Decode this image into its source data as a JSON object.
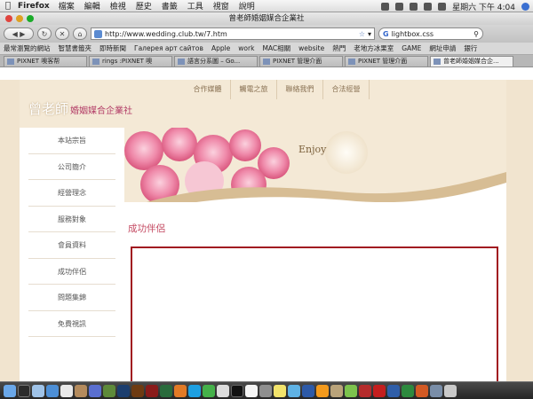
{
  "menubar": {
    "app": "Firefox",
    "items": [
      "檔案",
      "編輯",
      "檢視",
      "歷史",
      "書籤",
      "工具",
      "視窗",
      "說明"
    ],
    "clock": "星期六 下午 4:04"
  },
  "window": {
    "title": "曾老師婚姻媒合企業社"
  },
  "navbar": {
    "url": "http://www.wedding.club.tw/7.htm",
    "search_value": "lightbox.css",
    "search_engine_glyph": "G"
  },
  "bookmarks": [
    "最常瀏覽的網站",
    "智慧書籤夾",
    "即時新聞",
    "Галерея арт сайтов",
    "Apple",
    "work",
    "MAC相關",
    "website",
    "熱門",
    "老地方冰果室",
    "GAME",
    "網址申請",
    "銀行"
  ],
  "tabs": [
    {
      "label": "PIXNET 噢客帮"
    },
    {
      "label": "rings :PIXNET 噢"
    },
    {
      "label": "語言分系圖 – Go..."
    },
    {
      "label": "PIXNET 管理介面"
    },
    {
      "label": "PIXNET 管理介面"
    },
    {
      "label": "曾老師婚姻媒合企..."
    }
  ],
  "site": {
    "logo_name": "曾老師",
    "logo_sub": "婚姻媒合企業社",
    "top_nav": [
      "合作媒體",
      "觸電之旅",
      "聯絡我們",
      "合法經營"
    ],
    "side_nav": [
      "本站宗旨",
      "公司簡介",
      "經營理念",
      "服務對象",
      "會員資料",
      "成功伴侶",
      "問題集錦",
      "免費視訊"
    ],
    "banner_text": "Enjoy",
    "section_title": "成功伴侶"
  },
  "colors": {
    "page_bg": "#f1e4cf",
    "accent_pink": "#c44a62",
    "frame_border": "#a11820",
    "nav_text": "#8a7254"
  },
  "dock_icons": [
    "finder-icon",
    "dashboard-icon",
    "mail-icon",
    "safari-icon",
    "ical-icon",
    "address-book-icon",
    "itunes-icon",
    "iphoto-icon",
    "photoshop-icon",
    "illustrator-icon",
    "flash-icon",
    "dreamweaver-icon",
    "firefox-icon",
    "skype-icon",
    "msn-icon",
    "preview-icon",
    "terminal-icon",
    "textedit-icon",
    "system-preferences-icon",
    "stickies-icon",
    "ichat-icon",
    "quicktime-icon",
    "vlc-icon",
    "transmit-icon",
    "coda-icon",
    "filezilla-icon",
    "acrobat-icon",
    "word-icon",
    "excel-icon",
    "powerpoint-icon",
    "downloads-icon",
    "trash-icon"
  ]
}
